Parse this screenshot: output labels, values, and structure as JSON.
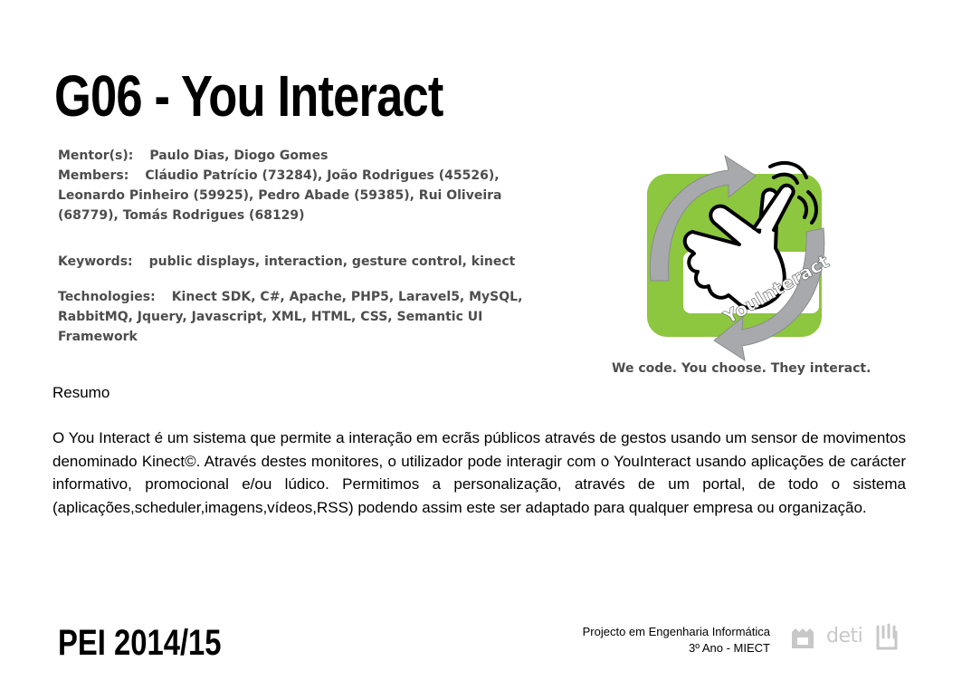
{
  "header": {
    "title": "G06 - You Interact"
  },
  "info": {
    "mentor_label": "Mentor(s):",
    "mentor_value": "Paulo Dias, Diogo Gomes",
    "members_label": "Members:",
    "members_value": "Cláudio Patrício (73284), João Rodrigues (45526), Leonardo Pinheiro (59925), Pedro Abade (59385), Rui Oliveira (68779), Tomás Rodrigues (68129)",
    "keywords_label": "Keywords:",
    "keywords_value": "public displays, interaction, gesture control, kinect",
    "technologies_label": "Technologies:",
    "technologies_value": "Kinect SDK, C#, Apache, PHP5, Laravel5, MySQL, RabbitMQ, Jquery, Javascript, XML, HTML, CSS, Semantic UI Framework"
  },
  "logo": {
    "text": "YouInteract",
    "tagline": "We code. You choose. They interact.",
    "colors": {
      "green": "#8dc63f",
      "gray": "#a7a9ac",
      "dark": "#58595b"
    }
  },
  "summary": {
    "heading": "Resumo",
    "body": "O You Interact é um sistema que permite a interação em ecrãs públicos através de gestos usando um sensor de movimentos denominado Kinect©. Através destes monitores, o utilizador pode interagir com o YouInteract usando aplicações de carácter informativo, promocional e/ou lúdico. Permitimos a personalização, através de um portal, de todo o sistema (aplicações,scheduler,imagens,vídeos,RSS) podendo assim este ser adaptado para qualquer empresa ou organização."
  },
  "footer": {
    "event": "PEI 2014/15",
    "course_line1": "Projecto em Engenharia Informática",
    "course_line2": "3º Ano - MIECT",
    "dept_logo_text": "deti"
  }
}
